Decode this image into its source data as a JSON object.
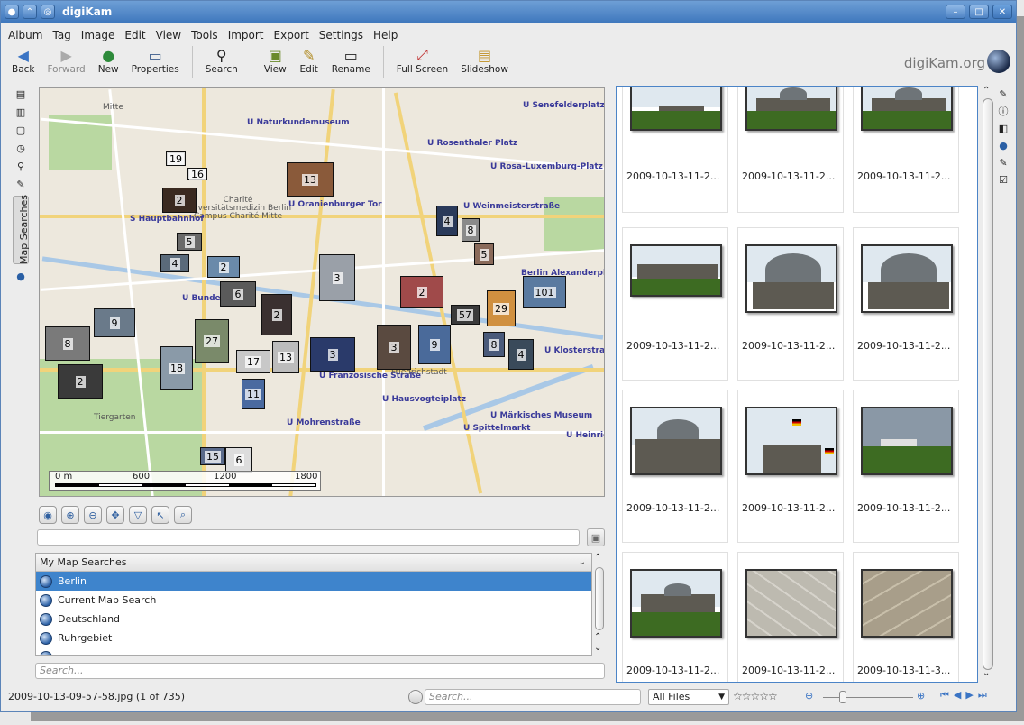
{
  "window": {
    "title": "digiKam"
  },
  "menu": [
    "Album",
    "Tag",
    "Image",
    "Edit",
    "View",
    "Tools",
    "Import",
    "Export",
    "Settings",
    "Help"
  ],
  "toolbar": {
    "back": "Back",
    "forward": "Forward",
    "new": "New",
    "properties": "Properties",
    "search": "Search",
    "view": "View",
    "edit": "Edit",
    "rename": "Rename",
    "full_screen": "Full Screen",
    "slideshow": "Slideshow",
    "brand": "digiKam.org"
  },
  "left_tab": {
    "label": "Map Searches"
  },
  "map": {
    "labels": [
      "Mitte",
      "U Naturkundemuseum",
      "U Senefelderplatz",
      "U Rosenthaler Platz",
      "U Rosa-Luxemburg-Platz",
      "U Oranienburger Tor",
      "Charité Universitätsmedizin Berlin Campus Charité Mitte",
      "S Hauptbahnhof",
      "U Weinmeisterstraße",
      "Berlin Alexanderplatz",
      "U Bundestag",
      "U Klosterstraße",
      "U Französische Straße",
      "U Hausvogteiplatz",
      "U Mohrenstraße",
      "U Märkisches Museum",
      "U Spittelmarkt",
      "Tiergarten",
      "Friedrichstadt",
      "U Heinrich"
    ],
    "markers": [
      "19",
      "16",
      "13",
      "2",
      "4",
      "8",
      "5",
      "5",
      "4",
      "2",
      "3",
      "6",
      "2",
      "2",
      "101",
      "57",
      "29",
      "8",
      "27",
      "3",
      "9",
      "3",
      "9",
      "8",
      "4",
      "18",
      "17",
      "13",
      "11",
      "15",
      "6",
      "2"
    ],
    "scale": {
      "ticks": [
        "0 m",
        "600",
        "1200",
        "1800"
      ]
    }
  },
  "searches": {
    "header": "My Map Searches",
    "items": [
      "Berlin",
      "Current Map Search",
      "Deutschland",
      "Ruhrgebiet"
    ],
    "selected": "Berlin",
    "filter_placeholder": "Search..."
  },
  "thumbnails": [
    "2009-10-13-11-2...",
    "2009-10-13-11-2...",
    "2009-10-13-11-2...",
    "2009-10-13-11-2...",
    "2009-10-13-11-2...",
    "2009-10-13-11-2...",
    "2009-10-13-11-2...",
    "2009-10-13-11-2...",
    "2009-10-13-11-2...",
    "2009-10-13-11-2...",
    "2009-10-13-11-2...",
    "2009-10-13-11-3..."
  ],
  "status": {
    "file": "2009-10-13-09-57-58.jpg (1 of 735)",
    "search_placeholder": "Search...",
    "filter": "All Files",
    "stars": "☆☆☆☆☆"
  }
}
